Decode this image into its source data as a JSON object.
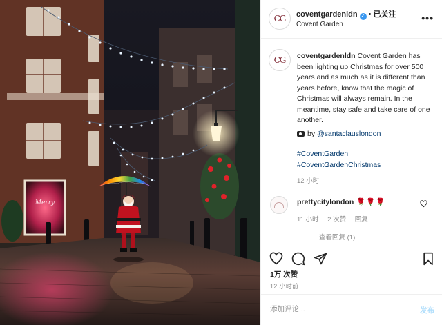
{
  "post": {
    "image_alt": "Santa Claus with a rainbow umbrella walking down a cobbled Covent Garden street at night under strings of Christmas lights"
  },
  "header": {
    "avatar_text": "CG",
    "username": "coventgardenldn",
    "verified_icon": "verified-badge-icon",
    "separator": "•",
    "follow_status": "已关注",
    "location": "Covent Garden",
    "more_icon": "more-options-icon"
  },
  "caption": {
    "username": "coventgardenldn",
    "text": "Covent Garden has been lighting up Christmas for over 500 years and as much as it is different than years before, know that the magic of Christmas will always remain. In the meantime, stay safe and take care of one another.",
    "credit_prefix": "by",
    "credit_handle": "@santaclauslondon",
    "hashtags": [
      "#CoventGarden",
      "#CoventGardenChristmas"
    ],
    "time": "12 小时"
  },
  "comment": {
    "username": "prettycitylondon",
    "text": "🌹🌹🌹",
    "time": "11 小时",
    "likes": "2 次赞",
    "reply": "回复",
    "view_replies": "查看回复 (1)"
  },
  "actions": {
    "icons": [
      "heart-icon",
      "comment-icon",
      "share-icon",
      "bookmark-icon"
    ],
    "likes": "1万 次赞",
    "time": "12 小时前"
  },
  "add_comment": {
    "placeholder": "添加评论...",
    "post_label": "发布"
  },
  "colors": {
    "link": "#00376b",
    "verified": "#3897f0",
    "post_button_disabled": "#b2dffc",
    "muted_text": "#8e8e8e"
  }
}
